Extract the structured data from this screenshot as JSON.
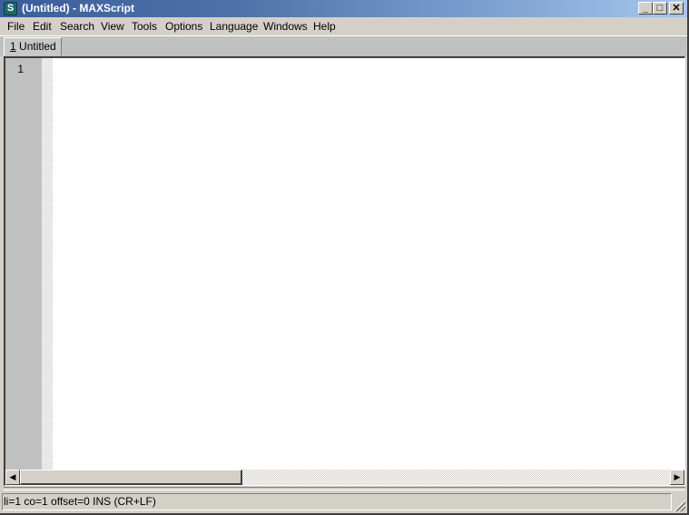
{
  "window": {
    "title": "(Untitled) - MAXScript",
    "app_icon": "maxscript-icon",
    "controls": {
      "minimize": "_",
      "maximize": "□",
      "close": "✕"
    }
  },
  "menubar": {
    "items": [
      {
        "label": "File"
      },
      {
        "label": "Edit"
      },
      {
        "label": "Search"
      },
      {
        "label": "View"
      },
      {
        "label": "Tools"
      },
      {
        "label": "Options"
      },
      {
        "label": "Language"
      },
      {
        "label": "Windows"
      },
      {
        "label": "Help"
      }
    ]
  },
  "tabs": [
    {
      "number": "1",
      "label": "Untitled",
      "active": true
    }
  ],
  "editor": {
    "line_numbers": [
      "1"
    ],
    "content": ""
  },
  "scrollbar": {
    "left_arrow": "◀",
    "right_arrow": "▶"
  },
  "statusbar": {
    "text": "li=1 co=1 offset=0 INS (CR+LF)"
  }
}
